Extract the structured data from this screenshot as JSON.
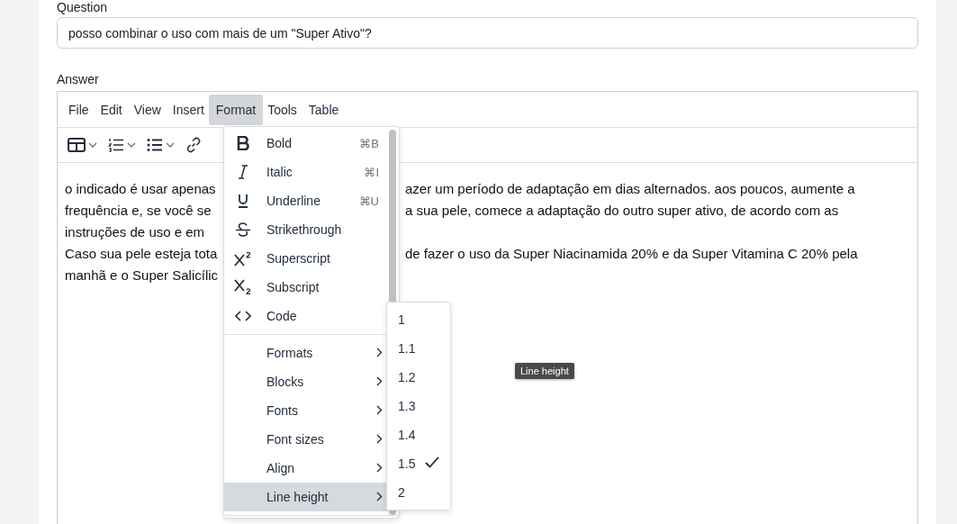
{
  "question": {
    "label": "Question",
    "value": "posso combinar o uso com mais de um \"Super Ativo\"?"
  },
  "answer": {
    "label": "Answer",
    "menubar": [
      {
        "label": "File",
        "selected": false
      },
      {
        "label": "Edit",
        "selected": false
      },
      {
        "label": "View",
        "selected": false
      },
      {
        "label": "Insert",
        "selected": false
      },
      {
        "label": "Format",
        "selected": true
      },
      {
        "label": "Tools",
        "selected": false
      },
      {
        "label": "Table",
        "selected": false
      }
    ],
    "content_lines": [
      {
        "left": "o indicado é usar apenas",
        "right": "azer um período de adaptação em dias alternados. aos poucos, aumente a"
      },
      {
        "left": "frequência e, se você se",
        "right": "a sua pele, comece a adaptação do outro super ativo, de acordo com as"
      },
      {
        "left": "instruções de uso e em"
      },
      {
        "left": "Caso sua pele esteja tota",
        "right": "de fazer o uso da Super Niacinamida 20% e da Super Vitamina C 20% pela"
      },
      {
        "left": "manhã e o Super Salicílic"
      }
    ],
    "format_menu": [
      {
        "kind": "command",
        "label": "Bold",
        "shortcut": "⌘B",
        "selected": false
      },
      {
        "kind": "command",
        "label": "Italic",
        "shortcut": "⌘I",
        "selected": false
      },
      {
        "kind": "command",
        "label": "Underline",
        "shortcut": "⌘U",
        "selected": false
      },
      {
        "kind": "command",
        "label": "Strikethrough",
        "selected": false
      },
      {
        "kind": "command",
        "label": "Superscript",
        "selected": false
      },
      {
        "kind": "command",
        "label": "Subscript",
        "selected": false
      },
      {
        "kind": "command",
        "label": "Code",
        "selected": false
      },
      {
        "kind": "separator"
      },
      {
        "kind": "submenu",
        "label": "Formats",
        "selected": false
      },
      {
        "kind": "submenu",
        "label": "Blocks",
        "selected": false
      },
      {
        "kind": "submenu",
        "label": "Fonts",
        "selected": false
      },
      {
        "kind": "submenu",
        "label": "Font sizes",
        "selected": false
      },
      {
        "kind": "submenu",
        "label": "Align",
        "selected": false
      },
      {
        "kind": "submenu",
        "label": "Line height",
        "selected": true
      },
      {
        "kind": "separator"
      }
    ],
    "line_height_menu": [
      {
        "label": "1",
        "selected": false
      },
      {
        "label": "1.1",
        "selected": false
      },
      {
        "label": "1.2",
        "selected": false
      },
      {
        "label": "1.3",
        "selected": false
      },
      {
        "label": "1.4",
        "selected": false
      },
      {
        "label": "1.5",
        "selected": true
      },
      {
        "label": "2",
        "selected": false
      }
    ],
    "tooltip": "Line height"
  }
}
